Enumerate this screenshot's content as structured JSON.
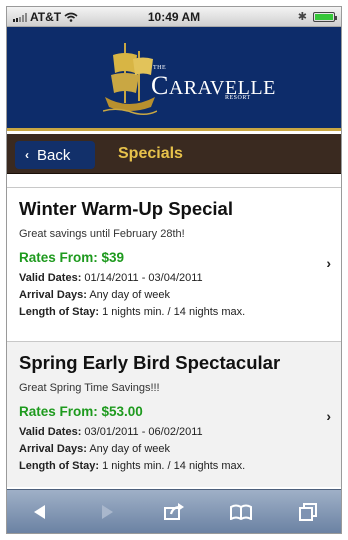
{
  "status_bar": {
    "carrier": "AT&T",
    "time": "10:49 AM"
  },
  "header": {
    "logo_the": "THE",
    "logo_c": "C",
    "logo_rest": "ARAVELLE",
    "logo_sub": "RESORT"
  },
  "navbar": {
    "back_label": "Back",
    "title": "Specials"
  },
  "specials": [
    {
      "title": "Winter Warm-Up Special",
      "subtitle": "Great savings until February 28th!",
      "rate": "Rates From: $39",
      "valid_label": "Valid Dates:",
      "valid_value": "01/14/2011 - 03/04/2011",
      "arrival_label": "Arrival Days:",
      "arrival_value": "Any day of week",
      "stay_label": "Length of Stay:",
      "stay_value": "1 nights min. / 14 nights max."
    },
    {
      "title": "Spring Early Bird Spectacular",
      "subtitle": "Great Spring Time Savings!!!",
      "rate": "Rates From: $53.00",
      "valid_label": "Valid Dates:",
      "valid_value": "03/01/2011 - 06/02/2011",
      "arrival_label": "Arrival Days:",
      "arrival_value": "Any day of week",
      "stay_label": "Length of Stay:",
      "stay_value": "1 nights min. / 14 nights max."
    }
  ],
  "colors": {
    "header_bg": "#0d2c6a",
    "nav_bg": "#3a2a20",
    "nav_title": "#e7c24b",
    "rate": "#1e9a1e",
    "toolbar": "#7f93b2"
  },
  "toolbar_icons": [
    "back-arrow-icon",
    "forward-arrow-icon",
    "share-icon",
    "bookmarks-icon",
    "pages-icon"
  ]
}
